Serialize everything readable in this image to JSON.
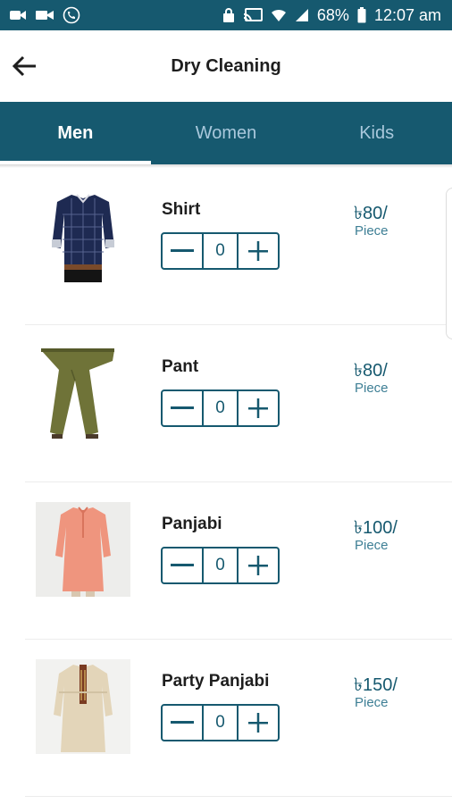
{
  "status_bar": {
    "battery": "68%",
    "time": "12:07 am",
    "icons": [
      "video-call-icon",
      "camcorder-icon",
      "wifi-call-icon",
      "lock-icon",
      "cast-icon",
      "wifi-icon",
      "signal-icon",
      "battery-icon"
    ]
  },
  "header": {
    "title": "Dry Cleaning",
    "back_icon": "arrow-left-icon"
  },
  "tabs": [
    {
      "label": "Men",
      "active": true
    },
    {
      "label": "Women",
      "active": false
    },
    {
      "label": "Kids",
      "active": false
    }
  ],
  "items": [
    {
      "name": "Shirt",
      "qty": "0",
      "price": "৳80/",
      "unit": "Piece"
    },
    {
      "name": "Pant",
      "qty": "0",
      "price": "৳80/",
      "unit": "Piece"
    },
    {
      "name": "Panjabi",
      "qty": "0",
      "price": "৳100/",
      "unit": "Piece"
    },
    {
      "name": "Party Panjabi",
      "qty": "0",
      "price": "৳150/",
      "unit": "Piece"
    }
  ],
  "colors": {
    "primary": "#16596f",
    "tab_inactive": "#a9c8dc",
    "text": "#1e1e1e"
  }
}
